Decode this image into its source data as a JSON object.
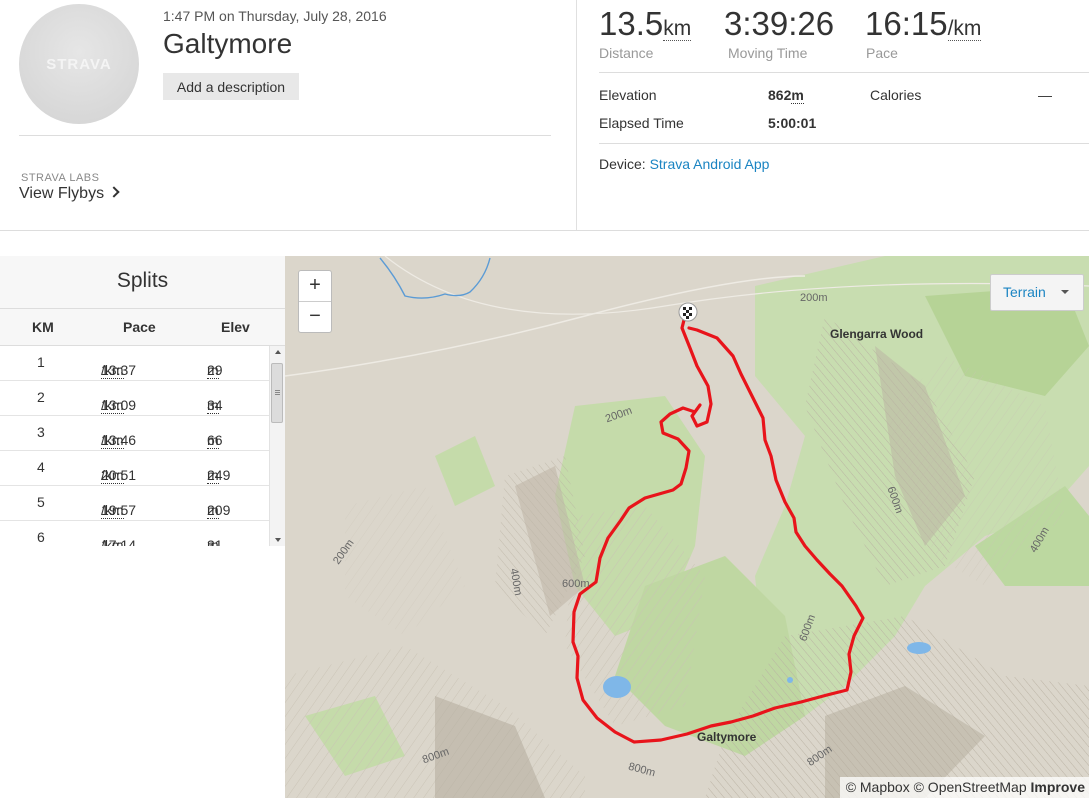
{
  "header": {
    "avatar_logo": "STRAVA",
    "datetime": "1:47 PM on Thursday, July 28, 2016",
    "title": "Galtymore",
    "add_description": "Add a description",
    "labs_label": "STRAVA LABS",
    "flybys_link": "View Flybys"
  },
  "stats": {
    "distance": {
      "value": "13.5",
      "unit": "km",
      "label": "Distance"
    },
    "moving_time": {
      "value": "3:39:26",
      "label": "Moving Time"
    },
    "pace": {
      "value": "16:15",
      "unit": "/km",
      "label": "Pace"
    },
    "elevation": {
      "label": "Elevation",
      "value": "862",
      "unit": "m"
    },
    "calories": {
      "label": "Calories",
      "value": "—"
    },
    "elapsed": {
      "label": "Elapsed Time",
      "value": "5:00:01"
    },
    "device": {
      "label": "Device:",
      "value": "Strava Android App"
    }
  },
  "splits": {
    "title": "Splits",
    "columns": [
      "KM",
      "Pace",
      "Elev"
    ],
    "pace_unit": "/km",
    "elev_unit": "m",
    "rows": [
      {
        "km": "1",
        "pace": "13:37",
        "elev": "29"
      },
      {
        "km": "2",
        "pace": "13:09",
        "elev": "34"
      },
      {
        "km": "3",
        "pace": "13:46",
        "elev": "66"
      },
      {
        "km": "4",
        "pace": "20:51",
        "elev": "249"
      },
      {
        "km": "5",
        "pace": "19:57",
        "elev": "209"
      },
      {
        "km": "6",
        "pace": "17:14",
        "elev": "31"
      }
    ]
  },
  "map": {
    "zoom_in": "+",
    "zoom_out": "−",
    "terrain_label": "Terrain",
    "labels": {
      "glengarra": "Glengarra Wood",
      "galtymore": "Galtymore",
      "c200a": "200m",
      "c200b": "200m",
      "c200c": "200m",
      "c400a": "400m",
      "c400b": "400m",
      "c600a": "600m",
      "c600b": "600m",
      "c600c": "600m",
      "c800a": "800m",
      "c800b": "800m",
      "c800c": "800m"
    },
    "attribution": {
      "mapbox": "© Mapbox",
      "osm": "© OpenStreetMap",
      "improve": "Improve"
    },
    "colors": {
      "route": "#e8141b",
      "water": "#7fb7e8",
      "woodland": "#bcd8a4",
      "terrain": "#d9d3c7"
    }
  }
}
